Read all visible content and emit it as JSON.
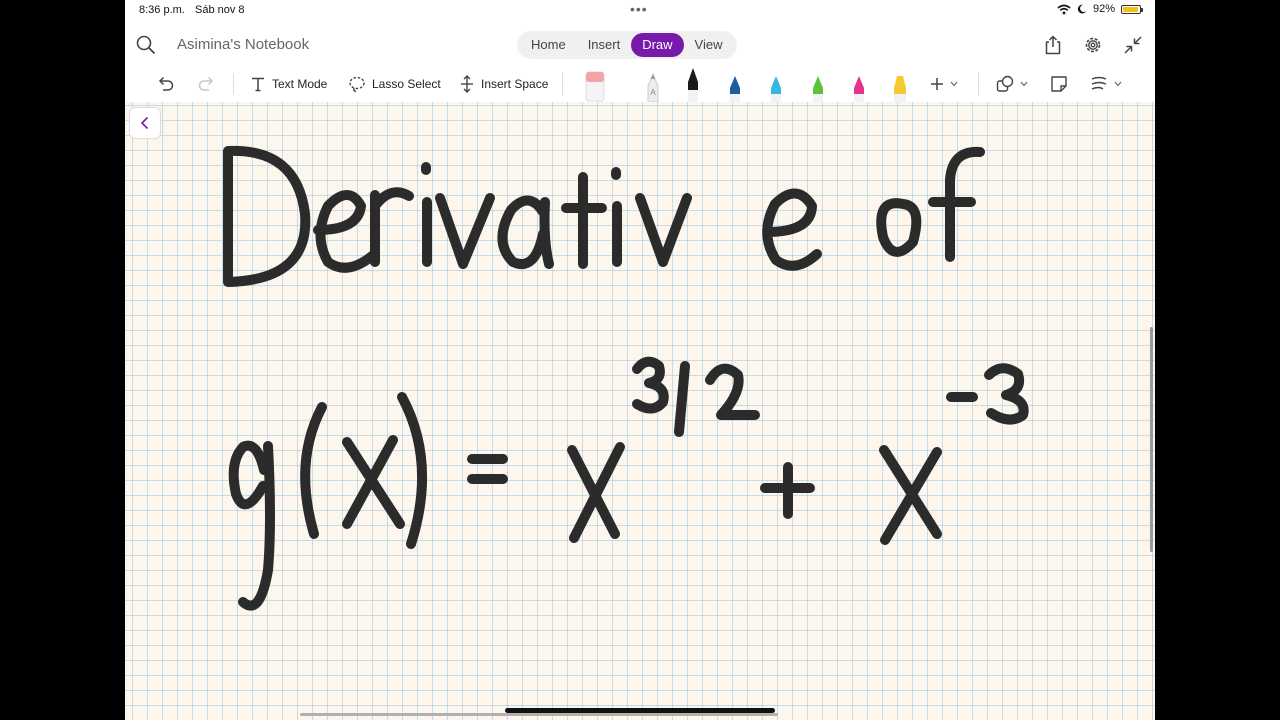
{
  "status": {
    "time": "8:36 p.m.",
    "date": "Sáb nov 8",
    "battery": "92%",
    "battery_level": 0.92
  },
  "titlebar": {
    "notebook_title": "Asimina's Notebook",
    "tabs": [
      {
        "label": "Home"
      },
      {
        "label": "Insert"
      },
      {
        "label": "Draw"
      },
      {
        "label": "View"
      }
    ],
    "active_tab": "Draw"
  },
  "toolbar": {
    "text_mode": "Text Mode",
    "lasso_select": "Lasso Select",
    "insert_space": "Insert Space",
    "pens": [
      {
        "name": "eraser",
        "color": "#f4a3a8"
      },
      {
        "name": "pencil",
        "color": "#b5b5b5"
      },
      {
        "name": "pen-black",
        "color": "#1a1a1a"
      },
      {
        "name": "pen-navy",
        "color": "#1d5aa0"
      },
      {
        "name": "pen-cyan",
        "color": "#37b6e6"
      },
      {
        "name": "pen-green",
        "color": "#5cc43b"
      },
      {
        "name": "pen-pink",
        "color": "#e8338a"
      },
      {
        "name": "highlighter-yellow",
        "color": "#f6c932"
      }
    ]
  },
  "colors": {
    "accent": "#7719aa",
    "ink": "#2b2b2b",
    "page": "#fdf6ec",
    "grid": "#96c8e6"
  },
  "note": {
    "line1": "Derivative of",
    "line2": "g(x) = x^(3/2) + x^(-3)",
    "expression": {
      "function": "g(x)",
      "base": "x",
      "exponent1": "3/2",
      "operator": "+",
      "exponent2": "-3"
    }
  }
}
